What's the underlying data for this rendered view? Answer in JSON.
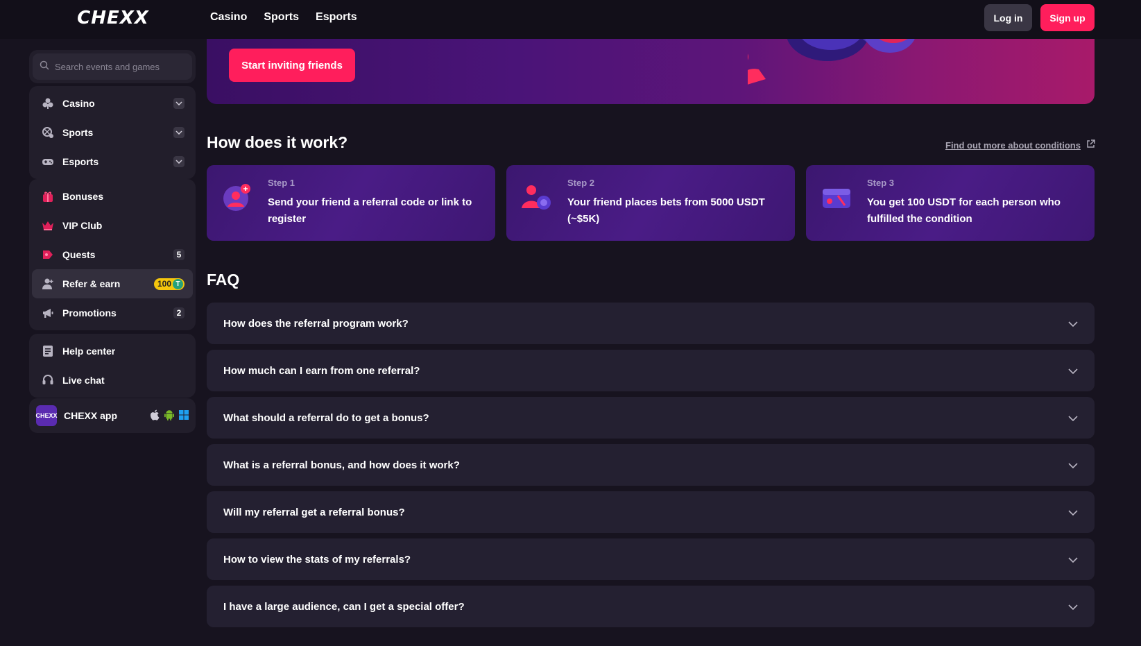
{
  "header": {
    "logo": "CHEXX",
    "nav": [
      "Casino",
      "Sports",
      "Esports"
    ],
    "login_label": "Log in",
    "signup_label": "Sign up"
  },
  "sidebar": {
    "search_placeholder": "Search events and games",
    "games": [
      {
        "label": "Casino",
        "icon": "casino-icon"
      },
      {
        "label": "Sports",
        "icon": "sports-icon"
      },
      {
        "label": "Esports",
        "icon": "gamepad-icon"
      }
    ],
    "rewards": [
      {
        "label": "Bonuses",
        "icon": "gift-icon"
      },
      {
        "label": "VIP Club",
        "icon": "crown-icon"
      },
      {
        "label": "Quests",
        "icon": "quest-icon",
        "count": "5"
      },
      {
        "label": "Refer & earn",
        "icon": "refer-icon",
        "badge": "100",
        "badge_token": "T"
      },
      {
        "label": "Promotions",
        "icon": "megaphone-icon",
        "count": "2"
      }
    ],
    "support": [
      {
        "label": "Help center",
        "icon": "book-icon"
      },
      {
        "label": "Live chat",
        "icon": "headset-icon"
      }
    ],
    "app": {
      "label": "CHEXX app",
      "logo_text": "CHEXX"
    }
  },
  "banner": {
    "invite_label": "Start inviting friends"
  },
  "how": {
    "title": "How does it work?",
    "more_link": "Find out more about conditions",
    "steps": [
      {
        "num": "Step 1",
        "text": "Send your friend a referral code or link to register"
      },
      {
        "num": "Step 2",
        "text": "Your friend places bets from 5000 USDT (~$5K)"
      },
      {
        "num": "Step 3",
        "text": "You get 100 USDT for each person who fulfilled the condition"
      }
    ]
  },
  "faq": {
    "title": "FAQ",
    "items": [
      "How does the referral program work?",
      "How much can I earn from one referral?",
      "What should a referral do to get a bonus?",
      "What is a referral bonus, and how does it work?",
      "Will my referral get a referral bonus?",
      "How to view the stats of my referrals?",
      "I have a large audience, can I get a special offer?"
    ]
  },
  "colors": {
    "accent": "#ff1e5c",
    "background": "#17131f",
    "panel": "#221e2b",
    "step_card": "#45197d",
    "faq_card": "#242031",
    "usdt_badge": "#f5c60d"
  }
}
